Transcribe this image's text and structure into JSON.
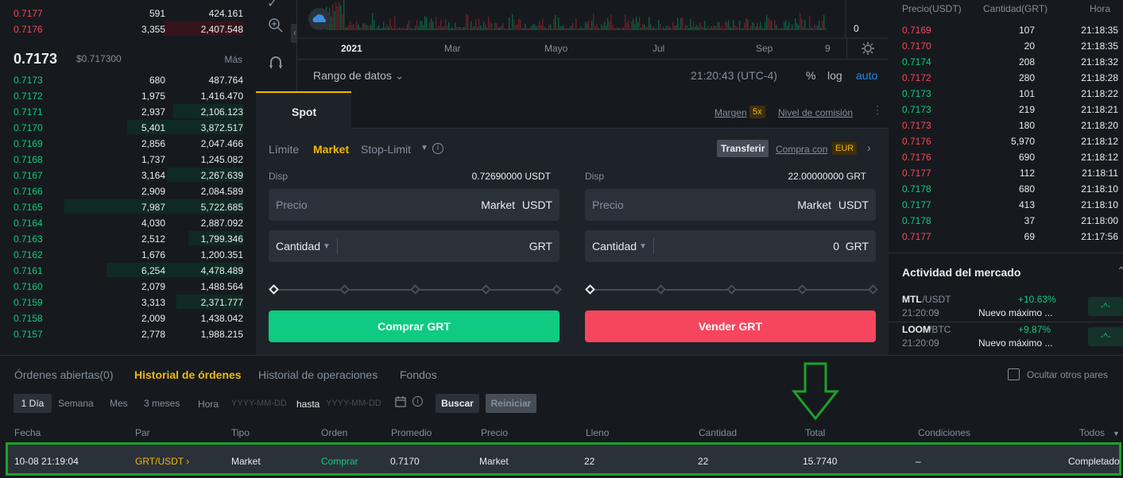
{
  "orderbook": {
    "asks": [
      {
        "price": "0.7177",
        "qty": "591",
        "total": "424.161",
        "depth": 0
      },
      {
        "price": "0.7176",
        "qty": "3,355",
        "total": "2,407.548",
        "depth": 100
      }
    ],
    "last_price": "0.7173",
    "last_price_usd": "$0.717300",
    "more_label": "Más",
    "bids": [
      {
        "price": "0.7173",
        "qty": "680",
        "total": "487.764",
        "depth": 0
      },
      {
        "price": "0.7172",
        "qty": "1,975",
        "total": "1,416.470",
        "depth": 0
      },
      {
        "price": "0.7171",
        "qty": "2,937",
        "total": "2,106.123",
        "depth": 88
      },
      {
        "price": "0.7170",
        "qty": "5,401",
        "total": "3,872.517",
        "depth": 146
      },
      {
        "price": "0.7169",
        "qty": "2,856",
        "total": "2,047.466",
        "depth": 0
      },
      {
        "price": "0.7168",
        "qty": "1,737",
        "total": "1,245.082",
        "depth": 0
      },
      {
        "price": "0.7167",
        "qty": "3,164",
        "total": "2,267.639",
        "depth": 96
      },
      {
        "price": "0.7166",
        "qty": "2,909",
        "total": "2,084.589",
        "depth": 0
      },
      {
        "price": "0.7165",
        "qty": "7,987",
        "total": "5,722.685",
        "depth": 225
      },
      {
        "price": "0.7164",
        "qty": "4,030",
        "total": "2,887.092",
        "depth": 0
      },
      {
        "price": "0.7163",
        "qty": "2,512",
        "total": "1,799.346",
        "depth": 69
      },
      {
        "price": "0.7162",
        "qty": "1,676",
        "total": "1,200.351",
        "depth": 0
      },
      {
        "price": "0.7161",
        "qty": "6,254",
        "total": "4,478.489",
        "depth": 172
      },
      {
        "price": "0.7160",
        "qty": "2,079",
        "total": "1,488.564",
        "depth": 0
      },
      {
        "price": "0.7159",
        "qty": "3,313",
        "total": "2,371.777",
        "depth": 84
      },
      {
        "price": "0.7158",
        "qty": "2,009",
        "total": "1,438.042",
        "depth": 0
      },
      {
        "price": "0.7157",
        "qty": "2,778",
        "total": "1,988.215",
        "depth": 0
      }
    ]
  },
  "chart": {
    "x_labels": [
      "2021",
      "Mar",
      "Mayo",
      "Jul",
      "Sep",
      "9"
    ],
    "y_zero": "0",
    "range_label": "Rango de datos",
    "time": "21:20:43 (UTC-4)",
    "pct": "%",
    "log": "log",
    "auto": "auto"
  },
  "trade": {
    "tab": "Spot",
    "margin_label": "Margen",
    "margin_badge": "5x",
    "fee_label": "Nivel de comisión",
    "types": [
      "Límite",
      "Market",
      "Stop-Limit"
    ],
    "transfer": "Transferir",
    "buy_with": "Compra con",
    "buy_with_currency": "EUR",
    "buy": {
      "disp_label": "Disp",
      "disp_value": "0.72690000 USDT",
      "price_placeholder": "Precio",
      "price_value": "Market",
      "price_unit": "USDT",
      "qty_label": "Cantidad",
      "qty_value": "",
      "qty_unit": "GRT",
      "button": "Comprar GRT"
    },
    "sell": {
      "disp_label": "Disp",
      "disp_value": "22.00000000 GRT",
      "price_placeholder": "Precio",
      "price_value": "Market",
      "price_unit": "USDT",
      "qty_label": "Cantidad",
      "qty_value": "0",
      "qty_unit": "GRT",
      "button": "Vender GRT"
    }
  },
  "trades": {
    "headers": [
      "Precio(USDT)",
      "Cantidad(GRT)",
      "Hora"
    ],
    "rows": [
      {
        "price": "0.7169",
        "qty": "107",
        "time": "21:18:35",
        "side": "sell"
      },
      {
        "price": "0.7170",
        "qty": "20",
        "time": "21:18:35",
        "side": "sell"
      },
      {
        "price": "0.7174",
        "qty": "208",
        "time": "21:18:32",
        "side": "buy"
      },
      {
        "price": "0.7172",
        "qty": "280",
        "time": "21:18:28",
        "side": "sell"
      },
      {
        "price": "0.7173",
        "qty": "101",
        "time": "21:18:22",
        "side": "buy"
      },
      {
        "price": "0.7173",
        "qty": "219",
        "time": "21:18:21",
        "side": "buy"
      },
      {
        "price": "0.7173",
        "qty": "180",
        "time": "21:18:20",
        "side": "sell"
      },
      {
        "price": "0.7176",
        "qty": "5,970",
        "time": "21:18:12",
        "side": "sell"
      },
      {
        "price": "0.7176",
        "qty": "690",
        "time": "21:18:12",
        "side": "sell"
      },
      {
        "price": "0.7177",
        "qty": "112",
        "time": "21:18:11",
        "side": "sell"
      },
      {
        "price": "0.7178",
        "qty": "680",
        "time": "21:18:10",
        "side": "buy"
      },
      {
        "price": "0.7177",
        "qty": "413",
        "time": "21:18:10",
        "side": "buy"
      },
      {
        "price": "0.7178",
        "qty": "37",
        "time": "21:18:00",
        "side": "buy"
      },
      {
        "price": "0.7177",
        "qty": "69",
        "time": "21:17:56",
        "side": "sell"
      }
    ],
    "market_title": "Actividad del mercado",
    "market": [
      {
        "pair": "MTL",
        "quote": "/USDT",
        "time": "21:20:09",
        "change": "+10.63%",
        "desc": "Nuevo máximo ..."
      },
      {
        "pair": "LOOM",
        "quote": "/BTC",
        "time": "21:20:09",
        "change": "+9.87%",
        "desc": "Nuevo máximo ..."
      }
    ]
  },
  "history": {
    "tabs": [
      "Órdenes abiertas(0)",
      "Historial de órdenes",
      "Historial de operaciones",
      "Fondos"
    ],
    "hide_pairs": "Ocultar otros pares",
    "periods": [
      "1 Día",
      "Semana",
      "Mes",
      "3 meses"
    ],
    "time_label": "Hora",
    "date_from": "YYYY-MM-DD",
    "until": "hasta",
    "date_to": "YYYY-MM-DD",
    "search": "Buscar",
    "reset": "Reiniciar",
    "columns": [
      "Fecha",
      "Par",
      "Tipo",
      "Orden",
      "Promedio",
      "Precio",
      "Lleno",
      "Cantidad",
      "Total",
      "Condiciones",
      "Todos"
    ],
    "row": {
      "date": "10-08 21:19:04",
      "pair": "GRT/USDT ›",
      "type": "Market",
      "side": "Comprar",
      "avg": "0.7170",
      "price": "Market",
      "filled": "22",
      "qty": "22",
      "total": "15.7740",
      "conditions": "–",
      "status": "Completado"
    }
  },
  "colors": {
    "annotation": "#1ea12a",
    "buy": "#0ecb81",
    "sell": "#f6465d",
    "accent": "#f0b90b"
  }
}
